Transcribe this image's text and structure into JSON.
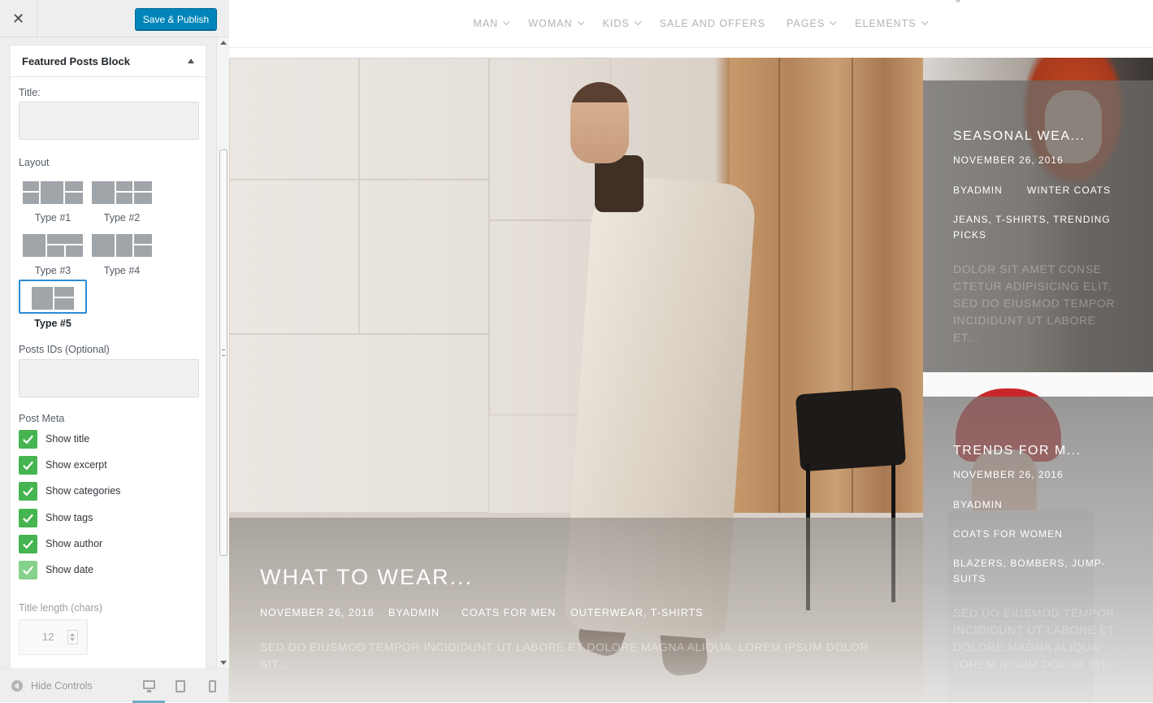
{
  "sidebar": {
    "close_label": "✕",
    "publish_label": "Save & Publish",
    "panel_title": "Featured Posts Block",
    "title_field_label": "Title:",
    "title_field_value": "",
    "layout_label": "Layout",
    "layouts": [
      {
        "name": "Type #1"
      },
      {
        "name": "Type #2"
      },
      {
        "name": "Type #3"
      },
      {
        "name": "Type #4"
      },
      {
        "name": "Type #5",
        "selected": true
      }
    ],
    "post_ids_label": "Posts IDs (Optional)",
    "post_ids_value": "",
    "post_meta_label": "Post Meta",
    "checkboxes": [
      {
        "label": "Show title",
        "checked": true
      },
      {
        "label": "Show excerpt",
        "checked": true
      },
      {
        "label": "Show categories",
        "checked": true
      },
      {
        "label": "Show tags",
        "checked": true
      },
      {
        "label": "Show author",
        "checked": true
      },
      {
        "label": "Show date",
        "checked": true
      }
    ],
    "title_length_label": "Title length (chars)",
    "title_length_value": "12",
    "hide_controls_label": "Hide Controls",
    "accent_color": "#0085ba",
    "check_color": "#46b450"
  },
  "nav": {
    "items": [
      "MAN",
      "WOMAN",
      "KIDS",
      "SALE AND OFFERS",
      "PAGES",
      "ELEMENTS"
    ]
  },
  "main_post": {
    "title": "WHAT TO WEAR...",
    "date": "NOVEMBER 26, 2016",
    "author": "BYADMIN",
    "category": "COATS FOR MEN",
    "tags": "OUTERWEAR, T-SHIRTS",
    "excerpt": "SED DO EIUSMOD TEMPOR INCIDIDUNT UT LABORE ET DOLORE MAGNA ALIQUA. LOREM IPSUM DOLOR SIT..."
  },
  "side_posts": [
    {
      "title": "SEASONAL WEA...",
      "date": "NOVEMBER 26, 2016",
      "author": "BYADMIN",
      "category": "WINTER COATS",
      "tags": "JEANS, T-SHIRTS, TRENDING PICKS",
      "excerpt": "DOLOR SIT AMET CONSE CTETUR ADIPISICING ELIT, SED DO EIUSMOD TEMPOR INCIDIDUNT UT LABORE ET..."
    },
    {
      "title": "TRENDS FOR M...",
      "date": "NOVEMBER 26, 2016",
      "author": "BYADMIN",
      "category": "COATS FOR WOMEN",
      "tags": "BLAZERS, BOMBERS, JUMP-SUITS",
      "excerpt": "SED DO EIUSMOD TEMPOR INCIDIDUNT UT LABORE ET DOLORE MAGNA ALIQUA. LOREM IPSUM DOLOR SIT..."
    }
  ]
}
